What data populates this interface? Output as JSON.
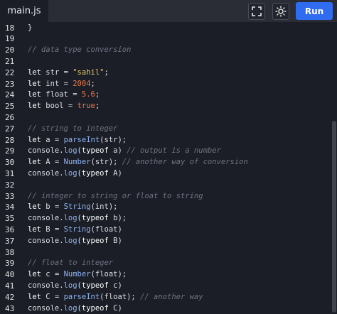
{
  "toolbar": {
    "tab_label": "main.js",
    "fullscreen_icon": "fullscreen-icon",
    "theme_icon": "sun-icon",
    "run_label": "Run",
    "run_color": "#2f6cf0"
  },
  "editor": {
    "lines": [
      {
        "num": "18",
        "tokens": [
          {
            "t": "}",
            "k": "plain"
          }
        ]
      },
      {
        "num": "19",
        "tokens": []
      },
      {
        "num": "20",
        "tokens": [
          {
            "t": "// data type conversion",
            "k": "comment"
          }
        ]
      },
      {
        "num": "21",
        "tokens": []
      },
      {
        "num": "22",
        "tokens": [
          {
            "t": "let ",
            "k": "keyword"
          },
          {
            "t": "str = ",
            "k": "plain"
          },
          {
            "t": "\"sahil\"",
            "k": "string"
          },
          {
            "t": ";",
            "k": "plain"
          }
        ]
      },
      {
        "num": "23",
        "tokens": [
          {
            "t": "let ",
            "k": "keyword"
          },
          {
            "t": "int = ",
            "k": "plain"
          },
          {
            "t": "2004",
            "k": "number"
          },
          {
            "t": ";",
            "k": "plain"
          }
        ]
      },
      {
        "num": "24",
        "tokens": [
          {
            "t": "let ",
            "k": "keyword"
          },
          {
            "t": "float = ",
            "k": "plain"
          },
          {
            "t": "5.6",
            "k": "number"
          },
          {
            "t": ";",
            "k": "plain"
          }
        ]
      },
      {
        "num": "25",
        "tokens": [
          {
            "t": "let ",
            "k": "keyword"
          },
          {
            "t": "bool = ",
            "k": "plain"
          },
          {
            "t": "true",
            "k": "bool"
          },
          {
            "t": ";",
            "k": "plain"
          }
        ]
      },
      {
        "num": "26",
        "tokens": []
      },
      {
        "num": "27",
        "tokens": [
          {
            "t": "// string to integer",
            "k": "comment"
          }
        ]
      },
      {
        "num": "28",
        "tokens": [
          {
            "t": "let ",
            "k": "keyword"
          },
          {
            "t": "a = ",
            "k": "plain"
          },
          {
            "t": "parseInt",
            "k": "func"
          },
          {
            "t": "(str);",
            "k": "plain"
          }
        ]
      },
      {
        "num": "29",
        "tokens": [
          {
            "t": "console.",
            "k": "plain"
          },
          {
            "t": "log",
            "k": "func"
          },
          {
            "t": "(",
            "k": "plain"
          },
          {
            "t": "typeof",
            "k": "keyword"
          },
          {
            "t": " a) ",
            "k": "plain"
          },
          {
            "t": "// output is a number",
            "k": "comment"
          }
        ]
      },
      {
        "num": "30",
        "tokens": [
          {
            "t": "let ",
            "k": "keyword"
          },
          {
            "t": "A = ",
            "k": "plain"
          },
          {
            "t": "Number",
            "k": "func"
          },
          {
            "t": "(str); ",
            "k": "plain"
          },
          {
            "t": "// another way of conversion",
            "k": "comment"
          }
        ]
      },
      {
        "num": "31",
        "tokens": [
          {
            "t": "console.",
            "k": "plain"
          },
          {
            "t": "log",
            "k": "func"
          },
          {
            "t": "(",
            "k": "plain"
          },
          {
            "t": "typeof",
            "k": "keyword"
          },
          {
            "t": " A)",
            "k": "plain"
          }
        ]
      },
      {
        "num": "32",
        "tokens": []
      },
      {
        "num": "33",
        "tokens": [
          {
            "t": "// integer to string or float to string",
            "k": "comment"
          }
        ]
      },
      {
        "num": "34",
        "tokens": [
          {
            "t": "let ",
            "k": "keyword"
          },
          {
            "t": "b = ",
            "k": "plain"
          },
          {
            "t": "String",
            "k": "func"
          },
          {
            "t": "(int);",
            "k": "plain"
          }
        ]
      },
      {
        "num": "35",
        "tokens": [
          {
            "t": "console.",
            "k": "plain"
          },
          {
            "t": "log",
            "k": "func"
          },
          {
            "t": "(",
            "k": "plain"
          },
          {
            "t": "typeof",
            "k": "keyword"
          },
          {
            "t": " b);",
            "k": "plain"
          }
        ]
      },
      {
        "num": "36",
        "tokens": [
          {
            "t": "let ",
            "k": "keyword"
          },
          {
            "t": "B = ",
            "k": "plain"
          },
          {
            "t": "String",
            "k": "func"
          },
          {
            "t": "(float)",
            "k": "plain"
          }
        ]
      },
      {
        "num": "37",
        "tokens": [
          {
            "t": "console.",
            "k": "plain"
          },
          {
            "t": "log",
            "k": "func"
          },
          {
            "t": "(",
            "k": "plain"
          },
          {
            "t": "typeof",
            "k": "keyword"
          },
          {
            "t": " B)",
            "k": "plain"
          }
        ]
      },
      {
        "num": "38",
        "tokens": []
      },
      {
        "num": "39",
        "tokens": [
          {
            "t": "// float to integer",
            "k": "comment"
          }
        ]
      },
      {
        "num": "40",
        "tokens": [
          {
            "t": "let ",
            "k": "keyword"
          },
          {
            "t": "c = ",
            "k": "plain"
          },
          {
            "t": "Number",
            "k": "func"
          },
          {
            "t": "(float);",
            "k": "plain"
          }
        ]
      },
      {
        "num": "41",
        "tokens": [
          {
            "t": "console.",
            "k": "plain"
          },
          {
            "t": "log",
            "k": "func"
          },
          {
            "t": "(",
            "k": "plain"
          },
          {
            "t": "typeof",
            "k": "keyword"
          },
          {
            "t": " c)",
            "k": "plain"
          }
        ]
      },
      {
        "num": "42",
        "tokens": [
          {
            "t": "let ",
            "k": "keyword"
          },
          {
            "t": "C = ",
            "k": "plain"
          },
          {
            "t": "parseInt",
            "k": "func"
          },
          {
            "t": "(float); ",
            "k": "plain"
          },
          {
            "t": "// another way",
            "k": "comment"
          }
        ]
      },
      {
        "num": "43",
        "tokens": [
          {
            "t": "console.",
            "k": "plain"
          },
          {
            "t": "log",
            "k": "func"
          },
          {
            "t": "(",
            "k": "plain"
          },
          {
            "t": "typeof",
            "k": "keyword"
          },
          {
            "t": " C)",
            "k": "plain"
          }
        ]
      }
    ]
  }
}
